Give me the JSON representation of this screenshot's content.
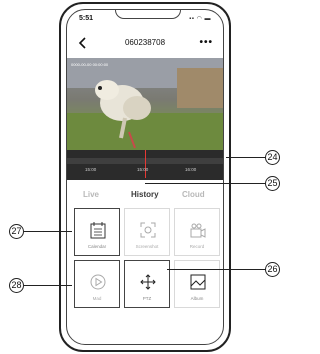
{
  "status_bar": {
    "time": "5:51",
    "icons": "▪▪ ◠ ▬"
  },
  "header": {
    "title": "060238708",
    "more": "•••"
  },
  "video": {
    "timestamp": "0000-00-00  00:00:00"
  },
  "timeline": {
    "labels": [
      "15:00",
      "15:00",
      "16:00"
    ]
  },
  "tabs": [
    {
      "label": "Live",
      "active": false
    },
    {
      "label": "History",
      "active": true
    },
    {
      "label": "Cloud",
      "active": false
    }
  ],
  "grid": [
    {
      "label": "Calendar",
      "icon": "calendar-icon"
    },
    {
      "label": "Screenshot",
      "icon": "screenshot-icon"
    },
    {
      "label": "Record",
      "icon": "video-camera-icon"
    },
    {
      "label": "Mad",
      "icon": "play-icon"
    },
    {
      "label": "PTZ",
      "icon": "ptz-arrows-icon"
    },
    {
      "label": "Album",
      "icon": "album-icon"
    }
  ],
  "callouts": [
    "24",
    "25",
    "26",
    "27",
    "28"
  ]
}
